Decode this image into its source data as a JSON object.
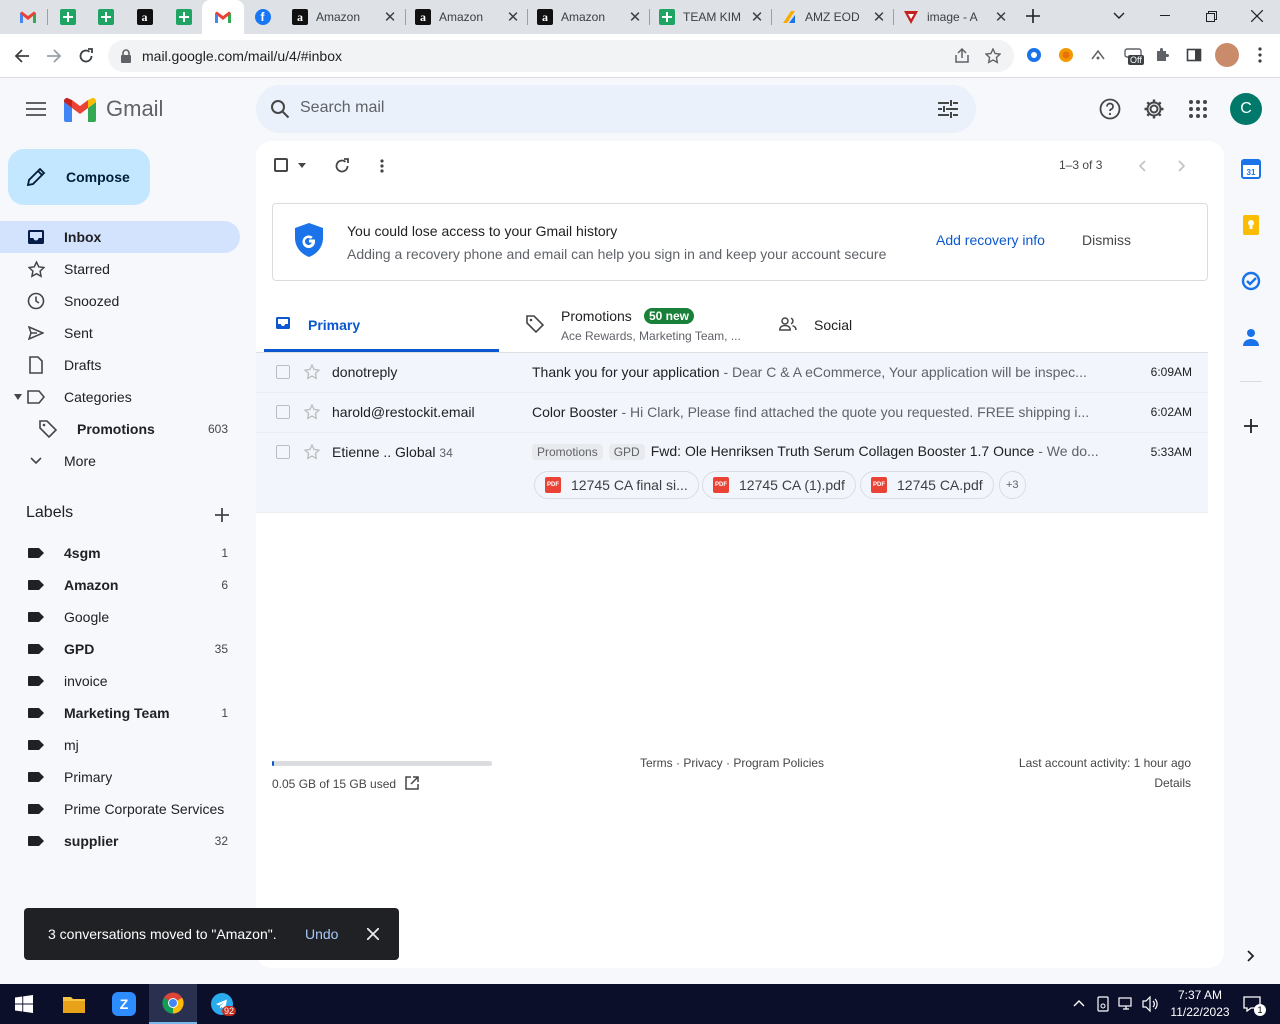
{
  "browser": {
    "tabs": [
      {
        "title": "",
        "icon": "gmail-icon"
      },
      {
        "title": "",
        "icon": "sheets-icon"
      },
      {
        "title": "",
        "icon": "sheets-icon"
      },
      {
        "title": "",
        "icon": "amazon-icon"
      },
      {
        "title": "",
        "icon": "sheets-icon"
      },
      {
        "title": "",
        "icon": "gmail-icon",
        "active": true
      },
      {
        "title": "",
        "icon": "facebook-icon"
      },
      {
        "title": "Amazon",
        "icon": "amazon-icon"
      },
      {
        "title": "Amazon",
        "icon": "amazon-icon"
      },
      {
        "title": "Amazon",
        "icon": "amazon-icon"
      },
      {
        "title": "TEAM KIM",
        "icon": "sheets-icon"
      },
      {
        "title": "AMZ EOD",
        "icon": "amz-eod-icon"
      },
      {
        "title": "image - A",
        "icon": "image-tab-icon"
      }
    ],
    "url": "mail.google.com/mail/u/4/#inbox",
    "extension_badge": "Off"
  },
  "gmail": {
    "logo_text": "Gmail",
    "search_placeholder": "Search mail",
    "avatar_letter": "C",
    "compose_label": "Compose",
    "nav": [
      {
        "label": "Inbox",
        "icon": "inbox-icon",
        "active": true
      },
      {
        "label": "Starred",
        "icon": "star-icon"
      },
      {
        "label": "Snoozed",
        "icon": "clock-icon"
      },
      {
        "label": "Sent",
        "icon": "send-icon"
      },
      {
        "label": "Drafts",
        "icon": "draft-icon"
      },
      {
        "label": "Categories",
        "icon": "label-outline-icon"
      },
      {
        "label": "Promotions",
        "icon": "tag-icon",
        "count": "603"
      },
      {
        "label": "More",
        "icon": "chevron-down-icon"
      }
    ],
    "labels_heading": "Labels",
    "labels": [
      {
        "name": "4sgm",
        "count": "1",
        "bold": true
      },
      {
        "name": "Amazon",
        "count": "6",
        "bold": true
      },
      {
        "name": "Google",
        "count": "",
        "bold": false
      },
      {
        "name": "GPD",
        "count": "35",
        "bold": true
      },
      {
        "name": "invoice",
        "count": "",
        "bold": false
      },
      {
        "name": "Marketing Team",
        "count": "1",
        "bold": true
      },
      {
        "name": "mj",
        "count": "",
        "bold": false
      },
      {
        "name": "Primary",
        "count": "",
        "bold": false
      },
      {
        "name": "Prime Corporate Services",
        "count": "",
        "bold": false
      },
      {
        "name": "supplier",
        "count": "32",
        "bold": true
      }
    ],
    "pagination": "1–3 of 3",
    "banner": {
      "title": "You could lose access to your Gmail history",
      "text": "Adding a recovery phone and email can help you sign in and keep your account secure",
      "action": "Add recovery info",
      "dismiss": "Dismiss"
    },
    "category_tabs": [
      {
        "label": "Primary",
        "icon": "inbox-icon",
        "active": true
      },
      {
        "label": "Promotions",
        "icon": "tag-icon",
        "badge": "50 new",
        "sub": "Ace Rewards, Marketing Team, ..."
      },
      {
        "label": "Social",
        "icon": "people-icon"
      }
    ],
    "emails": [
      {
        "sender": "donotreply",
        "count": "",
        "subject": "Thank you for your application",
        "snippet": " - Dear C & A eCommerce, Your application will be inspec...",
        "time": "6:09AM",
        "chips": []
      },
      {
        "sender": "harold@restockit.email",
        "count": "",
        "subject": "Color Booster",
        "snippet": " - Hi Clark, Please find attached the quote you requested. FREE shipping i...",
        "time": "6:02AM",
        "chips": []
      },
      {
        "sender": "Etienne .. Global",
        "count": "34",
        "subject": "Fwd: Ole Henriksen Truth Serum Collagen Booster 1.7 Ounce",
        "snippet": " - We do...",
        "time": "5:33AM",
        "chips": [
          "Promotions",
          "GPD"
        ]
      }
    ],
    "attachments": [
      "12745 CA final si...",
      "12745 CA (1).pdf",
      "12745 CA.pdf"
    ],
    "attachments_more": "+3",
    "storage": {
      "text": "0.05 GB of 15 GB used",
      "used_fraction": 0.0033
    },
    "footer_links": "Terms · Privacy · Program Policies",
    "last_activity": "Last account activity: 1 hour ago",
    "details": "Details",
    "snackbar": {
      "text": "3 conversations moved to \"Amazon\".",
      "undo": "Undo"
    }
  },
  "taskbar": {
    "time": "7:37 AM",
    "date": "11/22/2023",
    "telegram_badge": "92",
    "notification_count": "1"
  },
  "colors": {
    "accent": "#0b57d0",
    "active_nav": "#d3e3fd",
    "compose": "#c2e7ff",
    "badge_green": "#188038"
  }
}
